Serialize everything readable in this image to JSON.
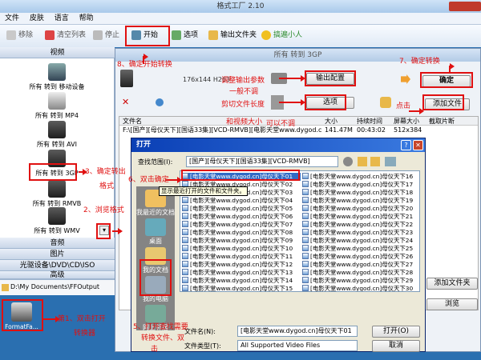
{
  "window": {
    "title": "格式工厂 2.10"
  },
  "menu": [
    "文件",
    "皮肤",
    "语言",
    "帮助"
  ],
  "toolbar": {
    "remove": "移除",
    "clear": "清空列表",
    "stop": "停止",
    "start": "开始",
    "options": "选项",
    "output_folder": "输出文件夹",
    "promo": "搞遍小人"
  },
  "sidebar": {
    "video": "视频",
    "items": [
      "所有 转到 移动设备",
      "所有 转到 MP4",
      "所有 转到 AVI",
      "所有 转到 3GP",
      "所有 转到 RMVB",
      "所有 转到 WMV"
    ],
    "audio": "音频",
    "image": "图片",
    "cdrom": "光驱设备\\DVD\\CD\\ISO",
    "advanced": "高级"
  },
  "statusbar": {
    "path": "D:\\My Documents\\FFOutput"
  },
  "desktop_icon": {
    "label": "FormatFa..."
  },
  "dialog3gp": {
    "title": "所有 转到 3GP",
    "profile": "176x144 H263",
    "output_config": "输出配置",
    "options": "选项",
    "ok": "确定",
    "add_file": "添加文件",
    "add_folder": "添加文件夹",
    "browse": "浏览",
    "columns": [
      "文件名",
      "大小",
      "持续时间",
      "屏幕大小",
      "截取片断"
    ],
    "row": {
      "name": "F:\\[国产][母仪天下][国语33集][VCD-RMVB][电影天堂www.dygod.cn]...",
      "size": "141.47M",
      "duration": "00:43:02",
      "screen": "512x384"
    }
  },
  "open_dialog": {
    "title": "打开",
    "lookin_label": "查找范围(I):",
    "lookin_value": "[国产][母仪天下][国语33集][VCD-RMVB]",
    "places": [
      "我最近的文档",
      "桌面",
      "我的文档",
      "我的电脑",
      "网上邻居"
    ],
    "tooltip": "显示最近打开的文件和文件夹。",
    "files_left": [
      "[电影天堂www.dygod.cn]母仪天下01",
      "[电影天堂www.dygod.cn]母仪天下02",
      "[电影天堂www.dygod.cn]母仪天下03",
      "[电影天堂www.dygod.cn]母仪天下04",
      "[电影天堂www.dygod.cn]母仪天下05",
      "[电影天堂www.dygod.cn]母仪天下06",
      "[电影天堂www.dygod.cn]母仪天下07",
      "[电影天堂www.dygod.cn]母仪天下08",
      "[电影天堂www.dygod.cn]母仪天下09",
      "[电影天堂www.dygod.cn]母仪天下10",
      "[电影天堂www.dygod.cn]母仪天下11",
      "[电影天堂www.dygod.cn]母仪天下12",
      "[电影天堂www.dygod.cn]母仪天下13",
      "[电影天堂www.dygod.cn]母仪天下14",
      "[电影天堂www.dygod.cn]母仪天下15"
    ],
    "files_right": [
      "[电影天堂www.dygod.cn]母仪天下16",
      "[电影天堂www.dygod.cn]母仪天下17",
      "[电影天堂www.dygod.cn]母仪天下18",
      "[电影天堂www.dygod.cn]母仪天下19",
      "[电影天堂www.dygod.cn]母仪天下20",
      "[电影天堂www.dygod.cn]母仪天下21",
      "[电影天堂www.dygod.cn]母仪天下22",
      "[电影天堂www.dygod.cn]母仪天下23",
      "[电影天堂www.dygod.cn]母仪天下24",
      "[电影天堂www.dygod.cn]母仪天下25",
      "[电影天堂www.dygod.cn]母仪天下26",
      "[电影天堂www.dygod.cn]母仪天下27",
      "[电影天堂www.dygod.cn]母仪天下28",
      "[电影天堂www.dygod.cn]母仪天下29",
      "[电影天堂www.dygod.cn]母仪天下30"
    ],
    "filename_label": "文件名(N):",
    "filename_value": "[电影天堂www.dygod.cn]母仪天下01",
    "filetype_label": "文件类型(T):",
    "filetype_value": "All Supported Video Files",
    "open_btn": "打开(O)",
    "cancel_btn": "取消"
  },
  "annotations": {
    "a1": "第1、双击打开",
    "a1b": "转换器",
    "a2": "2、浏览格式",
    "a3": "3、确定转出",
    "a3b": "格式",
    "a5": "5、打开查找需要",
    "a5b": "转换文件、双",
    "a5c": "击",
    "a6": "6、双击确定",
    "a7": "7、确定转换",
    "a8": "8、确定开始转换",
    "adjust1": "调整输出参数",
    "adjust2": "一般不调",
    "cut": "剪切文件长度",
    "videosize": "和视频大小",
    "canadjust": "可以不调",
    "click": "点击"
  }
}
